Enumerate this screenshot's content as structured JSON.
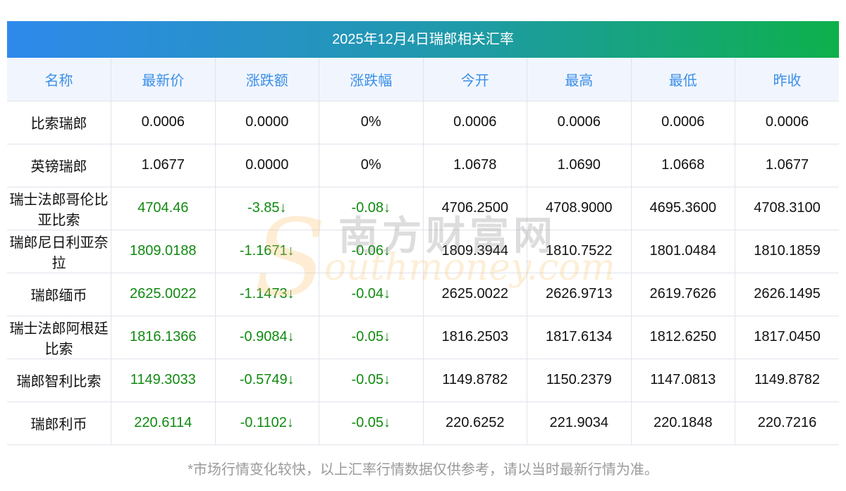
{
  "title": "2025年12月4日瑞郎相关汇率",
  "headers": [
    "名称",
    "最新价",
    "涨跌额",
    "涨跌幅",
    "今开",
    "最高",
    "最低",
    "昨收"
  ],
  "rows": [
    {
      "name": "比索瑞郎",
      "latest": "0.0006",
      "change": "0.0000",
      "pct": "0%",
      "open": "0.0006",
      "high": "0.0006",
      "low": "0.0006",
      "prev": "0.0006",
      "down": false
    },
    {
      "name": "英镑瑞郎",
      "latest": "1.0677",
      "change": "0.0000",
      "pct": "0%",
      "open": "1.0678",
      "high": "1.0690",
      "low": "1.0668",
      "prev": "1.0677",
      "down": false
    },
    {
      "name": "瑞士法郎哥伦比亚比索",
      "latest": "4704.46",
      "change": "-3.85↓",
      "pct": "-0.08↓",
      "open": "4706.2500",
      "high": "4708.9000",
      "low": "4695.3600",
      "prev": "4708.3100",
      "down": true
    },
    {
      "name": "瑞郎尼日利亚奈拉",
      "latest": "1809.0188",
      "change": "-1.1671↓",
      "pct": "-0.06↓",
      "open": "1809.3944",
      "high": "1810.7522",
      "low": "1801.0484",
      "prev": "1810.1859",
      "down": true
    },
    {
      "name": "瑞郎缅币",
      "latest": "2625.0022",
      "change": "-1.1473↓",
      "pct": "-0.04↓",
      "open": "2625.0022",
      "high": "2626.9713",
      "low": "2619.7626",
      "prev": "2626.1495",
      "down": true
    },
    {
      "name": "瑞士法郎阿根廷比索",
      "latest": "1816.1366",
      "change": "-0.9084↓",
      "pct": "-0.05↓",
      "open": "1816.2503",
      "high": "1817.6134",
      "low": "1812.6250",
      "prev": "1817.0450",
      "down": true
    },
    {
      "name": "瑞郎智利比索",
      "latest": "1149.3033",
      "change": "-0.5749↓",
      "pct": "-0.05↓",
      "open": "1149.8782",
      "high": "1150.2379",
      "low": "1147.0813",
      "prev": "1149.8782",
      "down": true
    },
    {
      "name": "瑞郎利币",
      "latest": "220.6114",
      "change": "-0.1102↓",
      "pct": "-0.05↓",
      "open": "220.6252",
      "high": "221.9034",
      "low": "220.1848",
      "prev": "220.7216",
      "down": true
    }
  ],
  "watermark": {
    "cn": "南方财富网",
    "en": "outhmoney.com",
    "s": "S"
  },
  "footer": "*市场行情变化较快，以上汇率行情数据仅供参考，请以当时最新行情为准。",
  "colors": {
    "header_text": "#3b8fe8",
    "down": "#118a11"
  }
}
